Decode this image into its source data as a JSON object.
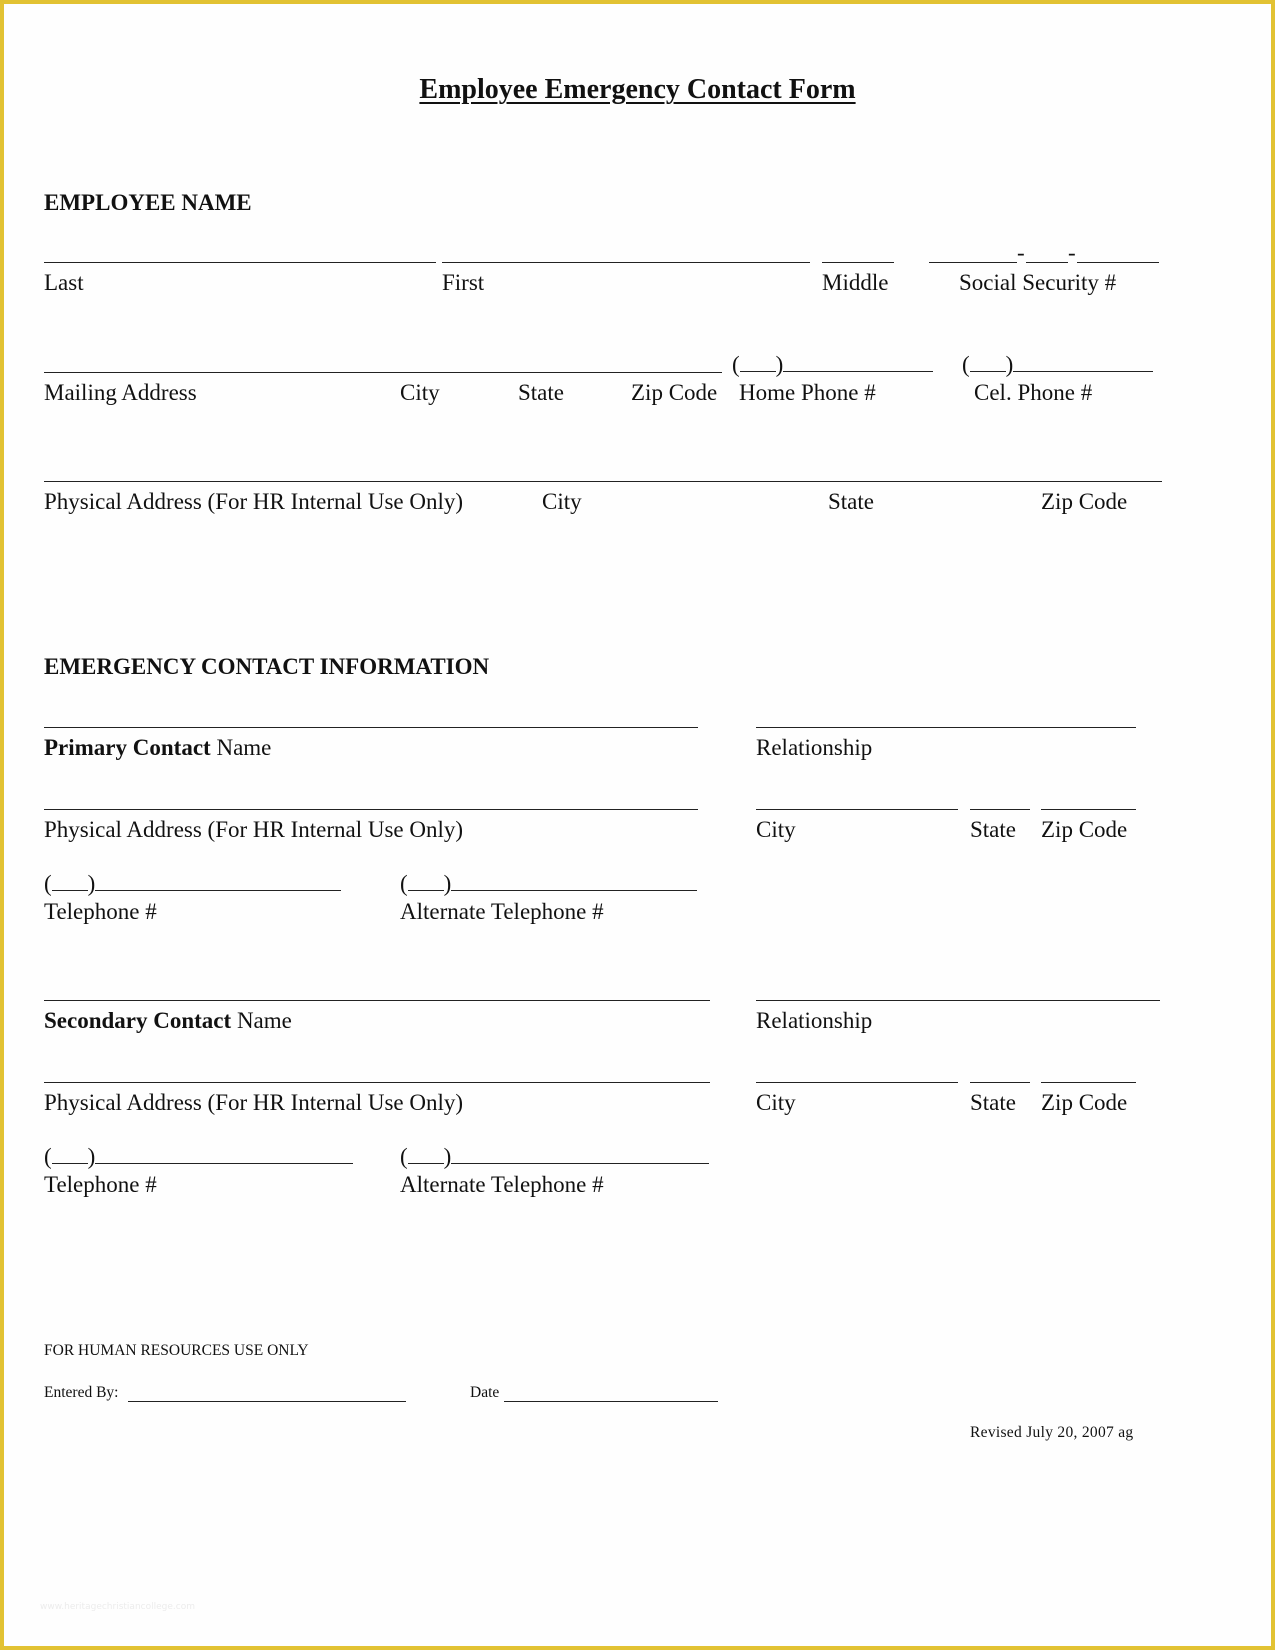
{
  "colors": {
    "border": "#e2c233",
    "page": "#fefefe",
    "ink": "#111111"
  },
  "title": "Employee Emergency Contact Form",
  "employee": {
    "heading": "EMPLOYEE NAME",
    "row1": {
      "last": "Last",
      "first": "First",
      "middle": "Middle",
      "ssn": "Social Security #",
      "ssn_sep": "-"
    },
    "row2": {
      "mailing_address": "Mailing Address",
      "city": "City",
      "state": "State",
      "zip": "Zip Code",
      "home_phone": "Home Phone #",
      "cell_phone": "Cel. Phone #",
      "area_open": "(",
      "area_close": ")"
    },
    "row3": {
      "physical_address": "Physical Address (For HR Internal Use Only)",
      "city": "City",
      "state": "State",
      "zip": "Zip Code"
    }
  },
  "emergency": {
    "heading": "EMERGENCY CONTACT INFORMATION",
    "primary": {
      "name_bold": "Primary Contact",
      "name_rest": " Name",
      "relationship": "Relationship",
      "physical_address": "Physical Address (For HR Internal Use Only)",
      "city": "City",
      "state": "State",
      "zip": "Zip Code",
      "telephone": "Telephone #",
      "alt_telephone": "Alternate Telephone #",
      "area_open": "(",
      "area_close": ")"
    },
    "secondary": {
      "name_bold": "Secondary Contact",
      "name_rest": " Name",
      "relationship": "Relationship",
      "physical_address": "Physical Address (For HR Internal Use Only)",
      "city": "City",
      "state": "State",
      "zip": "Zip Code",
      "telephone": "Telephone #",
      "alt_telephone": "Alternate Telephone #",
      "area_open": "(",
      "area_close": ")"
    }
  },
  "hr_use": {
    "heading": "FOR HUMAN RESOURCES USE ONLY",
    "entered_by": "Entered By:",
    "date": "Date"
  },
  "revised": "Revised July 20, 2007 ag",
  "watermark": "www.heritagechristiancollege.com"
}
